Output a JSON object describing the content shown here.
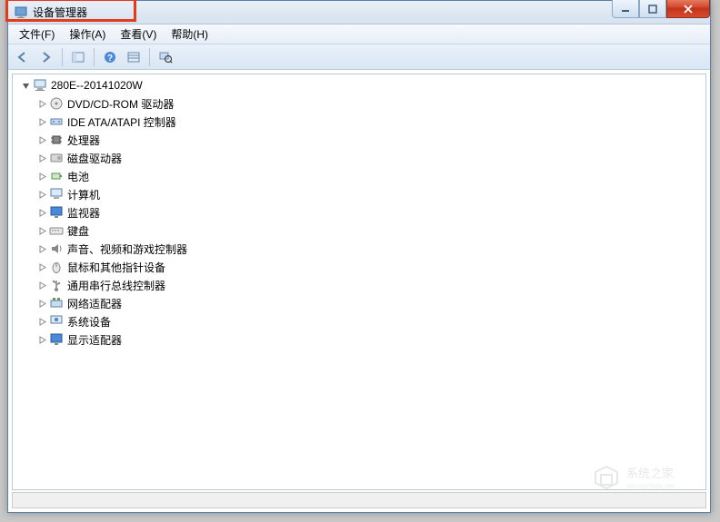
{
  "window": {
    "title": "设备管理器"
  },
  "menu": {
    "file": "文件(F)",
    "action": "操作(A)",
    "view": "查看(V)",
    "help": "帮助(H)"
  },
  "tree": {
    "root": "280E--20141020W",
    "items": [
      {
        "label": "DVD/CD-ROM 驱动器",
        "icon": "disc"
      },
      {
        "label": "IDE ATA/ATAPI 控制器",
        "icon": "ide"
      },
      {
        "label": "处理器",
        "icon": "cpu"
      },
      {
        "label": "磁盘驱动器",
        "icon": "disk"
      },
      {
        "label": "电池",
        "icon": "battery"
      },
      {
        "label": "计算机",
        "icon": "computer"
      },
      {
        "label": "监视器",
        "icon": "monitor"
      },
      {
        "label": "键盘",
        "icon": "keyboard"
      },
      {
        "label": "声音、视频和游戏控制器",
        "icon": "sound"
      },
      {
        "label": "鼠标和其他指针设备",
        "icon": "mouse"
      },
      {
        "label": "通用串行总线控制器",
        "icon": "usb"
      },
      {
        "label": "网络适配器",
        "icon": "network"
      },
      {
        "label": "系统设备",
        "icon": "system"
      },
      {
        "label": "显示适配器",
        "icon": "display"
      }
    ]
  },
  "watermark_center": "",
  "watermark_corner": "系统之家"
}
